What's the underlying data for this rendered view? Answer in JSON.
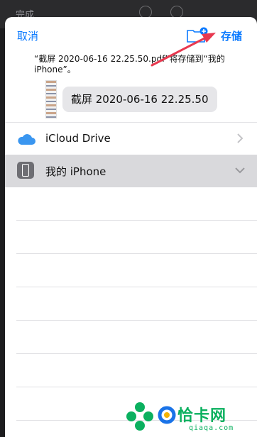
{
  "background_app": {
    "done_label": "完成"
  },
  "header": {
    "cancel_label": "取消",
    "new_folder_icon": "folder-add-icon",
    "save_label": "存储"
  },
  "save_message": "“截屏 2020-06-16 22.25.50.pdf”将存储到“我的 iPhone”。",
  "file": {
    "name": "截屏 2020-06-16 22.25.50"
  },
  "locations": [
    {
      "label": "iCloud Drive",
      "icon": "icloud-icon",
      "chevron": "chevron-right-icon",
      "selected": false
    },
    {
      "label": "我的 iPhone",
      "icon": "iphone-icon",
      "chevron": "chevron-down-icon",
      "selected": true
    }
  ],
  "watermark": {
    "title": "恰卡网",
    "subtitle": "qiaqa.com"
  },
  "colors": {
    "accent": "#0a7aff",
    "selected_row": "#d9d9dc",
    "annotation_arrow": "#e8384f",
    "watermark": "#0bb05f"
  }
}
